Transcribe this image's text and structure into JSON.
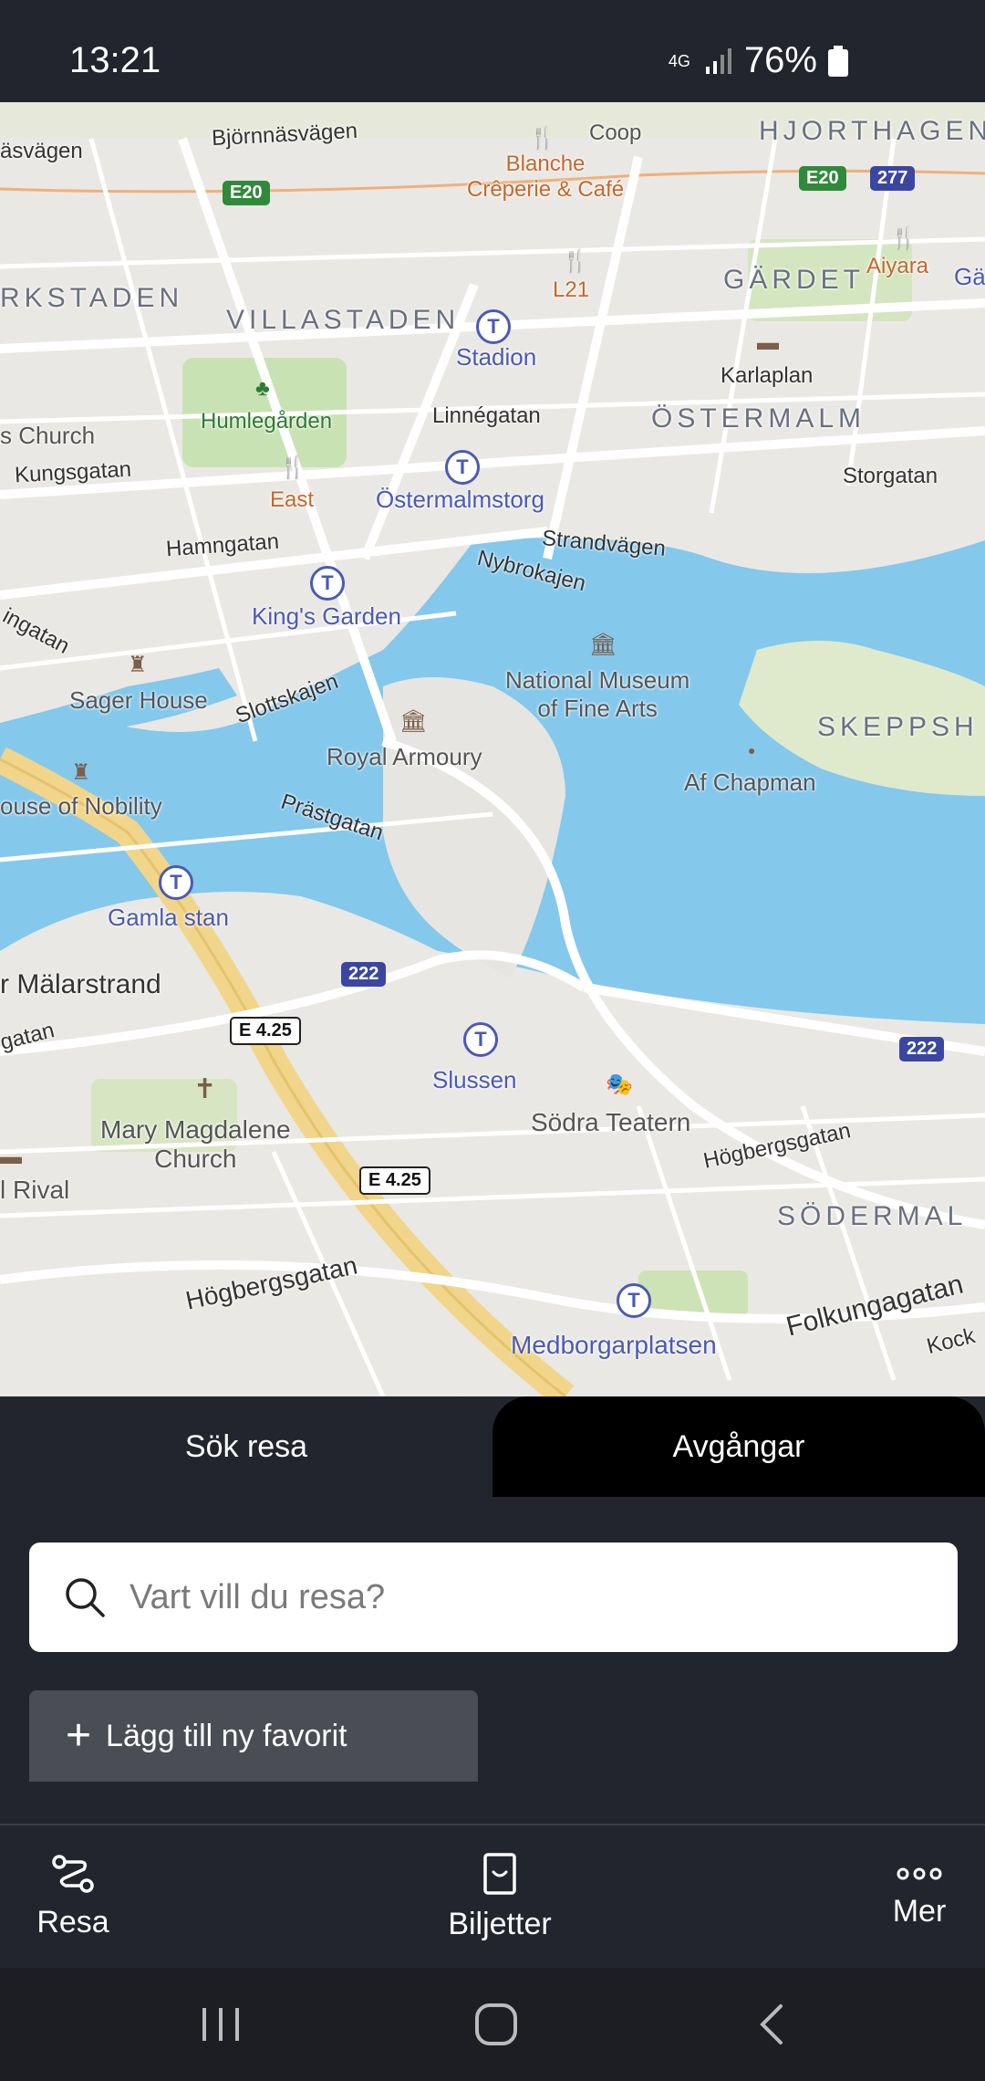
{
  "status_bar": {
    "time": "13:21",
    "network": "4G",
    "battery": "76%"
  },
  "map": {
    "districts": [
      "HJORTHAGEN",
      "GÄRDET",
      "VILLASTADEN",
      "ÖSTERMALM",
      "SKEPPSH",
      "SÖDERMAL",
      "RKSTADEN"
    ],
    "streets": [
      "Björnnäsvägen",
      "äsvägen",
      "Linnégatan",
      "Kungsgatan",
      "Hamngatan",
      "Strandvägen",
      "Nybrokajen",
      "Storgatan",
      "Slottskajen",
      "Prästgatan",
      "r Mälarstrand",
      "Högbergsgatan",
      "Högbergsgatan",
      "Folkungagatan",
      "Kock",
      "ingatan",
      "gatan"
    ],
    "metro_stations": [
      "Stadion",
      "Östermalmstorg",
      "King's Garden",
      "Gamla stan",
      "Slussen",
      "Medborgarplatsen"
    ],
    "places": [
      "Coop",
      "Blanche\nCrêperie & Café",
      "L21",
      "Aiyara",
      "East",
      "Karlaplan",
      "Humlegården",
      "s Church",
      "Sager House",
      "Royal Armoury",
      "National Museum\nof Fine Arts",
      "Af Chapman",
      "ouse of Nobility",
      "Mary Magdalene\nChurch",
      "Södra Teatern",
      "l Rival",
      "Gär"
    ],
    "road_shields": [
      "E20",
      "E20",
      "277",
      "222",
      "222",
      "E 4.25",
      "E 4.25"
    ]
  },
  "panel": {
    "tabs": [
      "Sök resa",
      "Avgångar"
    ],
    "search_placeholder": "Vart vill du resa?",
    "add_favorite": "Lägg till ny favorit"
  },
  "bottom_nav": {
    "items": [
      "Resa",
      "Biljetter",
      "Mer"
    ]
  }
}
